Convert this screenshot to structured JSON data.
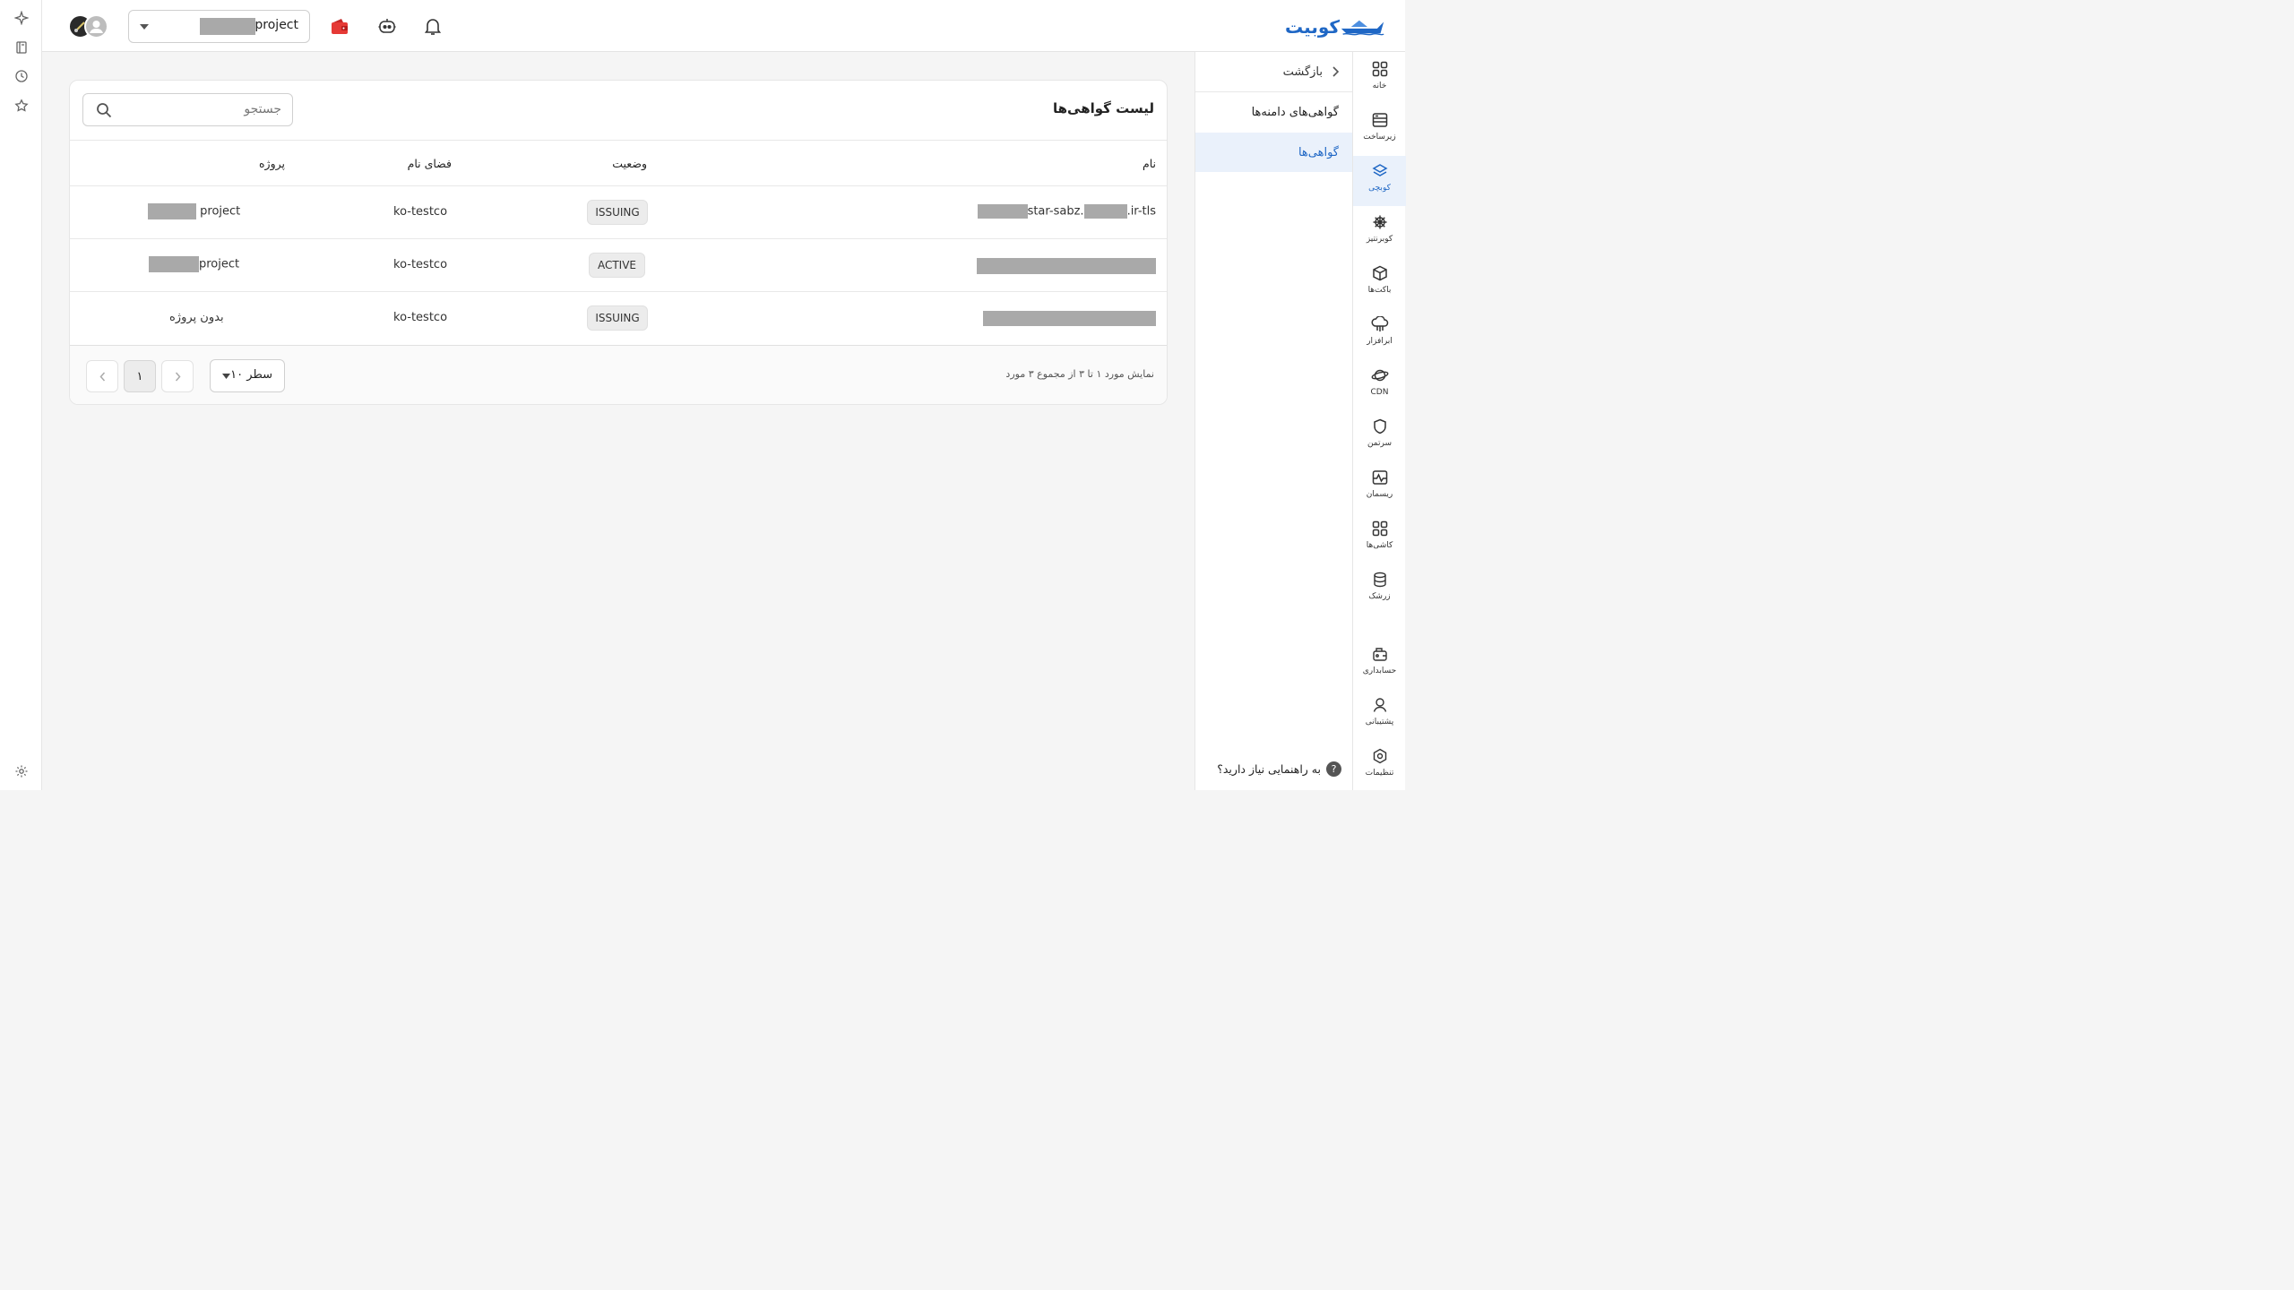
{
  "app": {
    "logo_text": "کوبیت"
  },
  "header": {
    "project_select": {
      "value": "project"
    }
  },
  "rail": {
    "items": [
      {
        "label": "خانه",
        "icon": "grid-icon"
      },
      {
        "label": "زیرساخت",
        "icon": "server-icon"
      },
      {
        "label": "کوبچی",
        "icon": "layers-icon"
      },
      {
        "label": "کوبرنتیز",
        "icon": "helm-icon"
      },
      {
        "label": "باکت‌ها",
        "icon": "box-icon"
      },
      {
        "label": "ابرافزار",
        "icon": "cloud-app-icon"
      },
      {
        "label": "CDN",
        "icon": "planet-icon"
      },
      {
        "label": "سرتمن",
        "icon": "shield-icon"
      },
      {
        "label": "ریسمان",
        "icon": "pulse-icon"
      },
      {
        "label": "کاشی‌ها",
        "icon": "tiles-icon"
      },
      {
        "label": "زرشک",
        "icon": "database-icon"
      },
      {
        "label": "حسابداری",
        "icon": "accounting-icon"
      },
      {
        "label": "پشتیبانی",
        "icon": "support-icon"
      },
      {
        "label": "تنظیمات",
        "icon": "settings-icon"
      }
    ]
  },
  "subnav": {
    "back_label": "بازگشت",
    "items": [
      {
        "label": "گواهی‌های دامنه‌ها"
      },
      {
        "label": "گواهی‌ها"
      }
    ],
    "help_label": "به راهنمایی نیاز دارید؟"
  },
  "card": {
    "title": "لیست گواهی‌ها",
    "search_placeholder": "جستجو",
    "columns": {
      "name": "نام",
      "status": "وضعیت",
      "namespace": "فضای نام",
      "project": "پروژه"
    },
    "rows": [
      {
        "name_parts": [
          "star-sabz.",
          ".ir-tls"
        ],
        "status": "ISSUING",
        "namespace": "ko-testco",
        "project": "project"
      },
      {
        "name_parts": [],
        "status": "ACTIVE",
        "namespace": "ko-testco",
        "project": "project"
      },
      {
        "name_parts": [],
        "status": "ISSUING",
        "namespace": "ko-testco",
        "project": "بدون پروژه"
      }
    ],
    "pagination": {
      "summary": "نمایش مورد ۱ تا ۳ از مجموع ۳ مورد",
      "page_size": "۱۰ سطر",
      "current_page": "۱"
    }
  },
  "colors": {
    "accent": "#1f67c5",
    "wallet": "#e53935"
  }
}
